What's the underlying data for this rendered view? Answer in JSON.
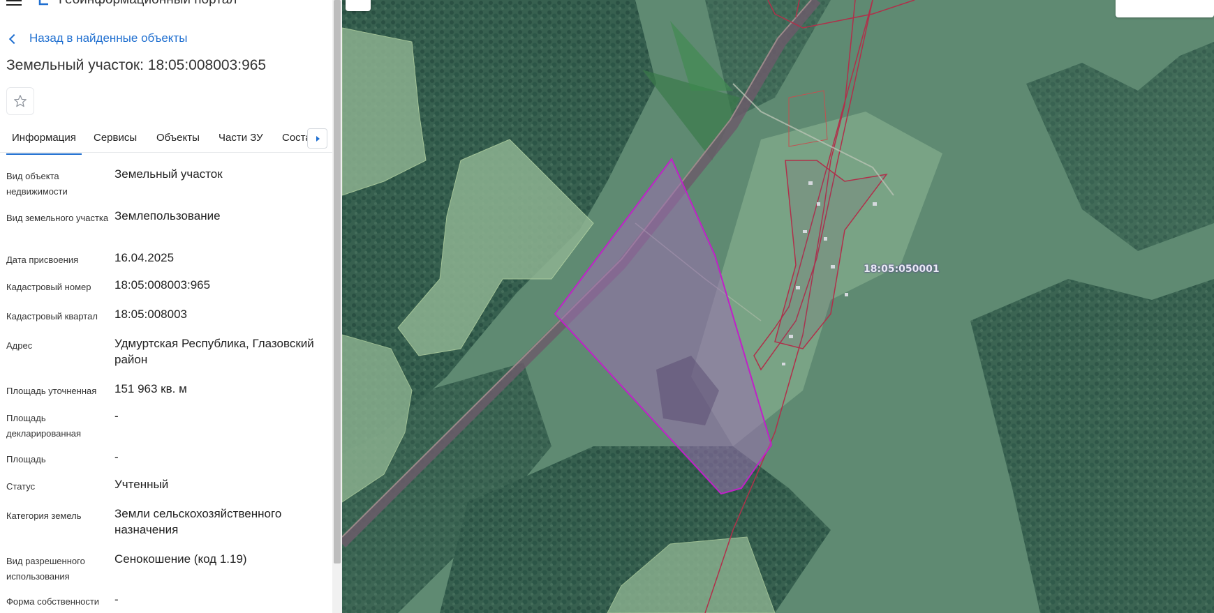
{
  "header": {
    "portal_title": "Геоинформационный портал"
  },
  "back_link": "Назад в найденные объекты",
  "title": "Земельный участок: 18:05:008003:965",
  "tabs": [
    {
      "label": "Информация"
    },
    {
      "label": "Сервисы"
    },
    {
      "label": "Объекты"
    },
    {
      "label": "Части ЗУ"
    },
    {
      "label": "Соста"
    }
  ],
  "info": [
    {
      "label": "Вид объекта недвижимости",
      "value": "Земельный участок"
    },
    {
      "label": "Вид земельного участка",
      "value": "Землепользование"
    },
    {
      "label": "Дата присвоения",
      "value": "16.04.2025"
    },
    {
      "label": "Кадастровый номер",
      "value": "18:05:008003:965"
    },
    {
      "label": "Кадастровый квартал",
      "value": "18:05:008003"
    },
    {
      "label": "Адрес",
      "value": "Удмуртская Республика, Глазовский район"
    },
    {
      "label": "Площадь уточненная",
      "value": "151 963 кв. м"
    },
    {
      "label": "Площадь декларированная",
      "value": "-"
    },
    {
      "label": "Площадь",
      "value": "-"
    },
    {
      "label": "Статус",
      "value": "Учтенный"
    },
    {
      "label": "Категория земель",
      "value": "Земли сельскохозяйственного назначения"
    },
    {
      "label": "Вид разрешенного использования",
      "value": "Сенокошение (код 1.19)"
    },
    {
      "label": "Форма собственности",
      "value": "-"
    }
  ],
  "map": {
    "quarter_label": "18:05:050001",
    "colors": {
      "parcel_outline": "#c021c8",
      "parcel_fill": "#9a6fb0",
      "cadastre_lines": "#b0304a",
      "forest": "#2f5a4c",
      "field": "#6f9b80",
      "accent": "#1f6fd0"
    }
  },
  "icons": {
    "menu": "hamburger-icon",
    "logo": "portal-logo-icon",
    "back": "chevron-left-icon",
    "favorite": "star-outline-icon",
    "tabs_scroll": "caret-right-icon",
    "collapse": "double-chevron-left-icon"
  }
}
